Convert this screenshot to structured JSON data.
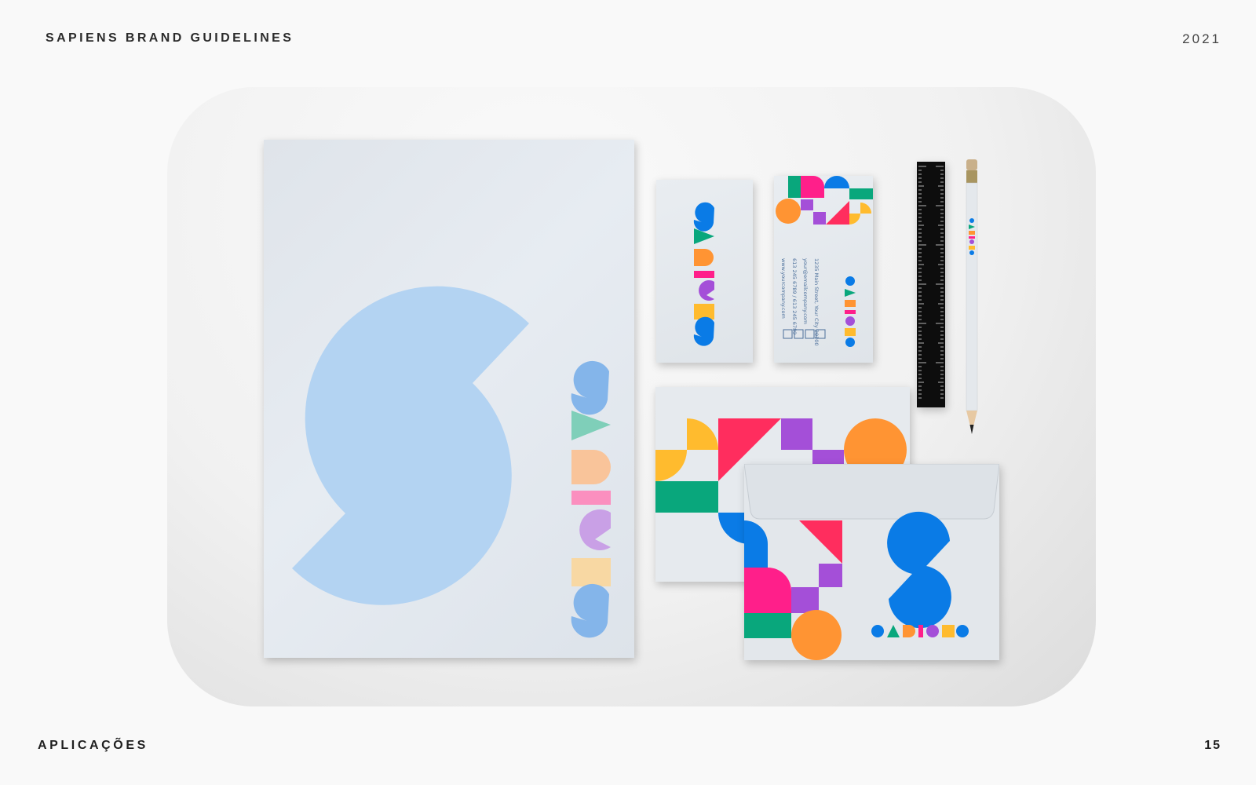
{
  "header": {
    "title": "SAPIENS BRAND GUIDELINES",
    "year": "2021"
  },
  "footer": {
    "section": "APLICAÇÕES",
    "page_number": "15"
  },
  "mockup": {
    "brand_name": "SAPIENS",
    "business_card": {
      "address": "1235 Main Street, Your City 20100",
      "email": "your@emailcompany.com",
      "phone": "613 245 6789 / 613 245 6789",
      "website": "www.yourcompany.com"
    }
  },
  "colors": {
    "blue": "#0a7be6",
    "green": "#09a77c",
    "pink": "#ff1f8a",
    "purple": "#a44fd8",
    "orange": "#ff9433",
    "yellow": "#ffbb2e",
    "red": "#ff2d5e"
  }
}
